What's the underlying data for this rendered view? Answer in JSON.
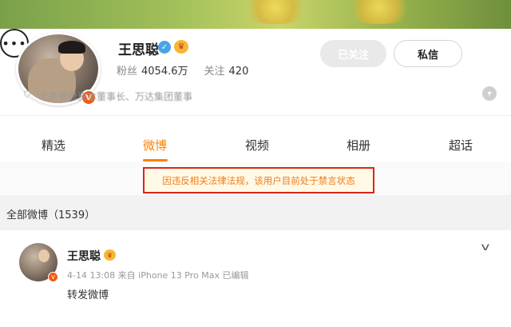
{
  "profile": {
    "name": "王思聪",
    "badge_v": "V",
    "fans_label": "粉丝",
    "fans_value": "4054.6万",
    "following_label": "关注",
    "following_value": "420",
    "bio": "北京普思资本董事长、万达集团董事"
  },
  "actions": {
    "followed_label": "已关注",
    "message_label": "私信",
    "more_label": "•••"
  },
  "tabs": [
    {
      "label": "精选",
      "active": false
    },
    {
      "label": "微博",
      "active": true
    },
    {
      "label": "视频",
      "active": false
    },
    {
      "label": "相册",
      "active": false
    },
    {
      "label": "超话",
      "active": false
    }
  ],
  "notice": "因违反相关法律法规，该用户目前处于禁言状态",
  "feed": {
    "section_title": "全部微博（1539）",
    "post": {
      "author": "王思聪",
      "meta": "4-14 13:08  来自 iPhone 13 Pro Max 已编辑",
      "text": "转发微博"
    }
  },
  "colors": {
    "accent": "#ff8200",
    "notice_border": "#d9261c",
    "verified": "#f25a15"
  }
}
